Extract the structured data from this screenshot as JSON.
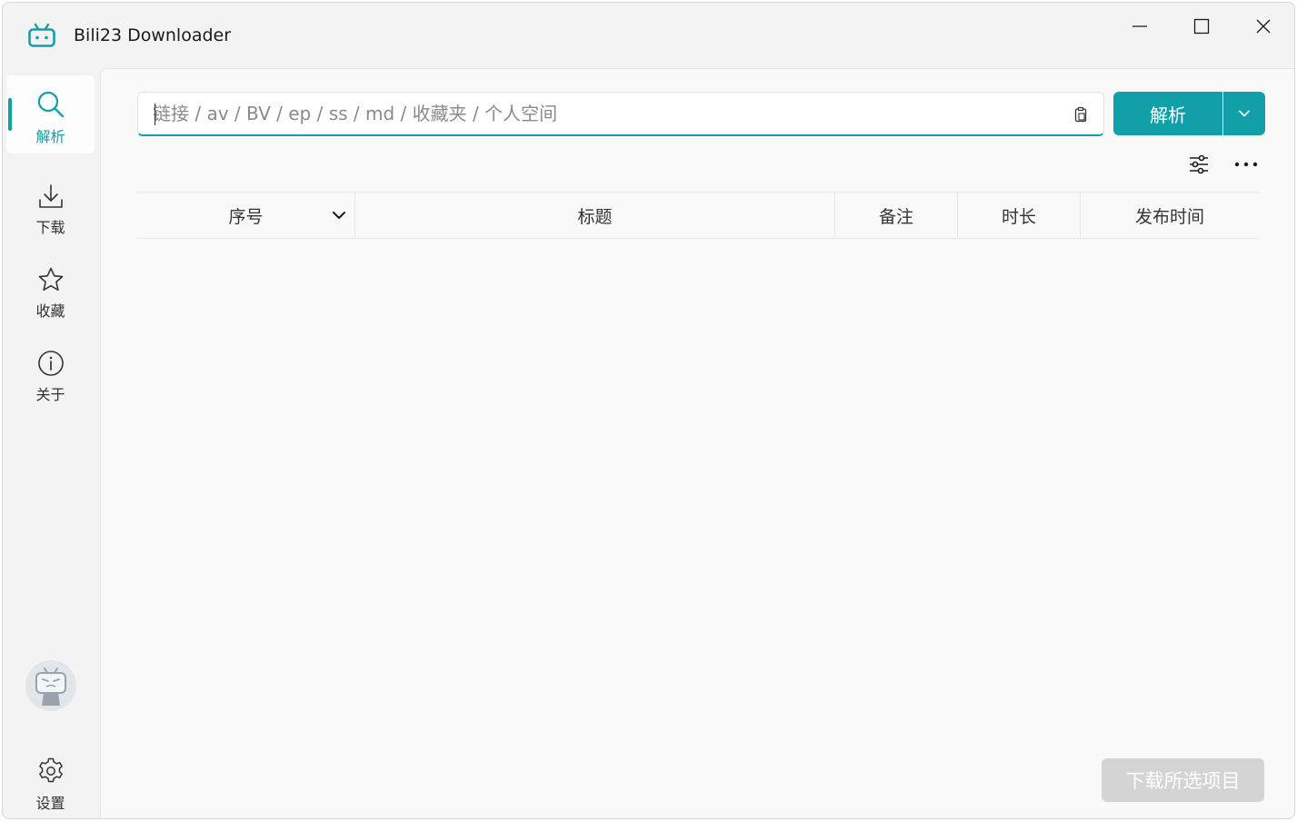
{
  "app": {
    "title": "Bili23 Downloader",
    "brand_color": "#12a0a8"
  },
  "window_controls": {
    "minimize": "minimize-icon",
    "maximize": "maximize-icon",
    "close": "close-icon"
  },
  "sidebar": {
    "items": [
      {
        "label": "解析",
        "icon": "search-icon",
        "active": true
      },
      {
        "label": "下载",
        "icon": "download-icon",
        "active": false
      },
      {
        "label": "收藏",
        "icon": "star-icon",
        "active": false
      },
      {
        "label": "关于",
        "icon": "info-icon",
        "active": false
      }
    ],
    "settings": {
      "label": "设置",
      "icon": "gear-icon"
    }
  },
  "search": {
    "placeholder": "链接 / av / BV / ep / ss / md / 收藏夹 / 个人空间",
    "value": "",
    "paste_icon": "clipboard-icon"
  },
  "parse_button": {
    "label": "解析",
    "dropdown_icon": "chevron-down-icon"
  },
  "toolbar": {
    "filter_icon": "sliders-icon",
    "more_icon": "more-icon"
  },
  "table": {
    "columns": [
      "序号",
      "标题",
      "备注",
      "时长",
      "发布时间"
    ],
    "rows": []
  },
  "footer": {
    "download_selected_label": "下载所选项目"
  }
}
